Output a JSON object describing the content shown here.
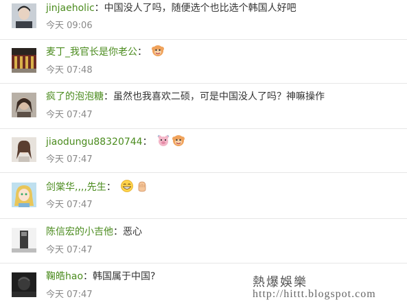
{
  "comments": [
    {
      "user": "jinjaeholic",
      "text": "中国没人了吗，随便选个也比选个韩国人好吧",
      "time": "今天 09:06"
    },
    {
      "user": "麦丁_我官长是你老公",
      "text": "",
      "time": "今天 07:48"
    },
    {
      "user": "疯了的泡泡糖",
      "text": "虽然也我喜欢二硕，可是中国没人了吗？神嘛操作",
      "time": "今天 07:47"
    },
    {
      "user": "jiaodungu88320744",
      "text": "",
      "time": "今天 07:47"
    },
    {
      "user": "剑棠华,,,,先生",
      "text": "",
      "time": "今天 07:47"
    },
    {
      "user": "陈信宏的小吉他",
      "text": "恶心",
      "time": "今天 07:47"
    },
    {
      "user": "鞠皓hao",
      "text": "韩国属于中国?",
      "time": "今天 07:47"
    }
  ],
  "colon": "：",
  "watermark": {
    "title": "熱爆娛樂",
    "url": "http://hittt.blogspot.com"
  },
  "colors": {
    "username": "#4a8b1d",
    "time": "#888888",
    "separator": "#e6e6e6"
  }
}
